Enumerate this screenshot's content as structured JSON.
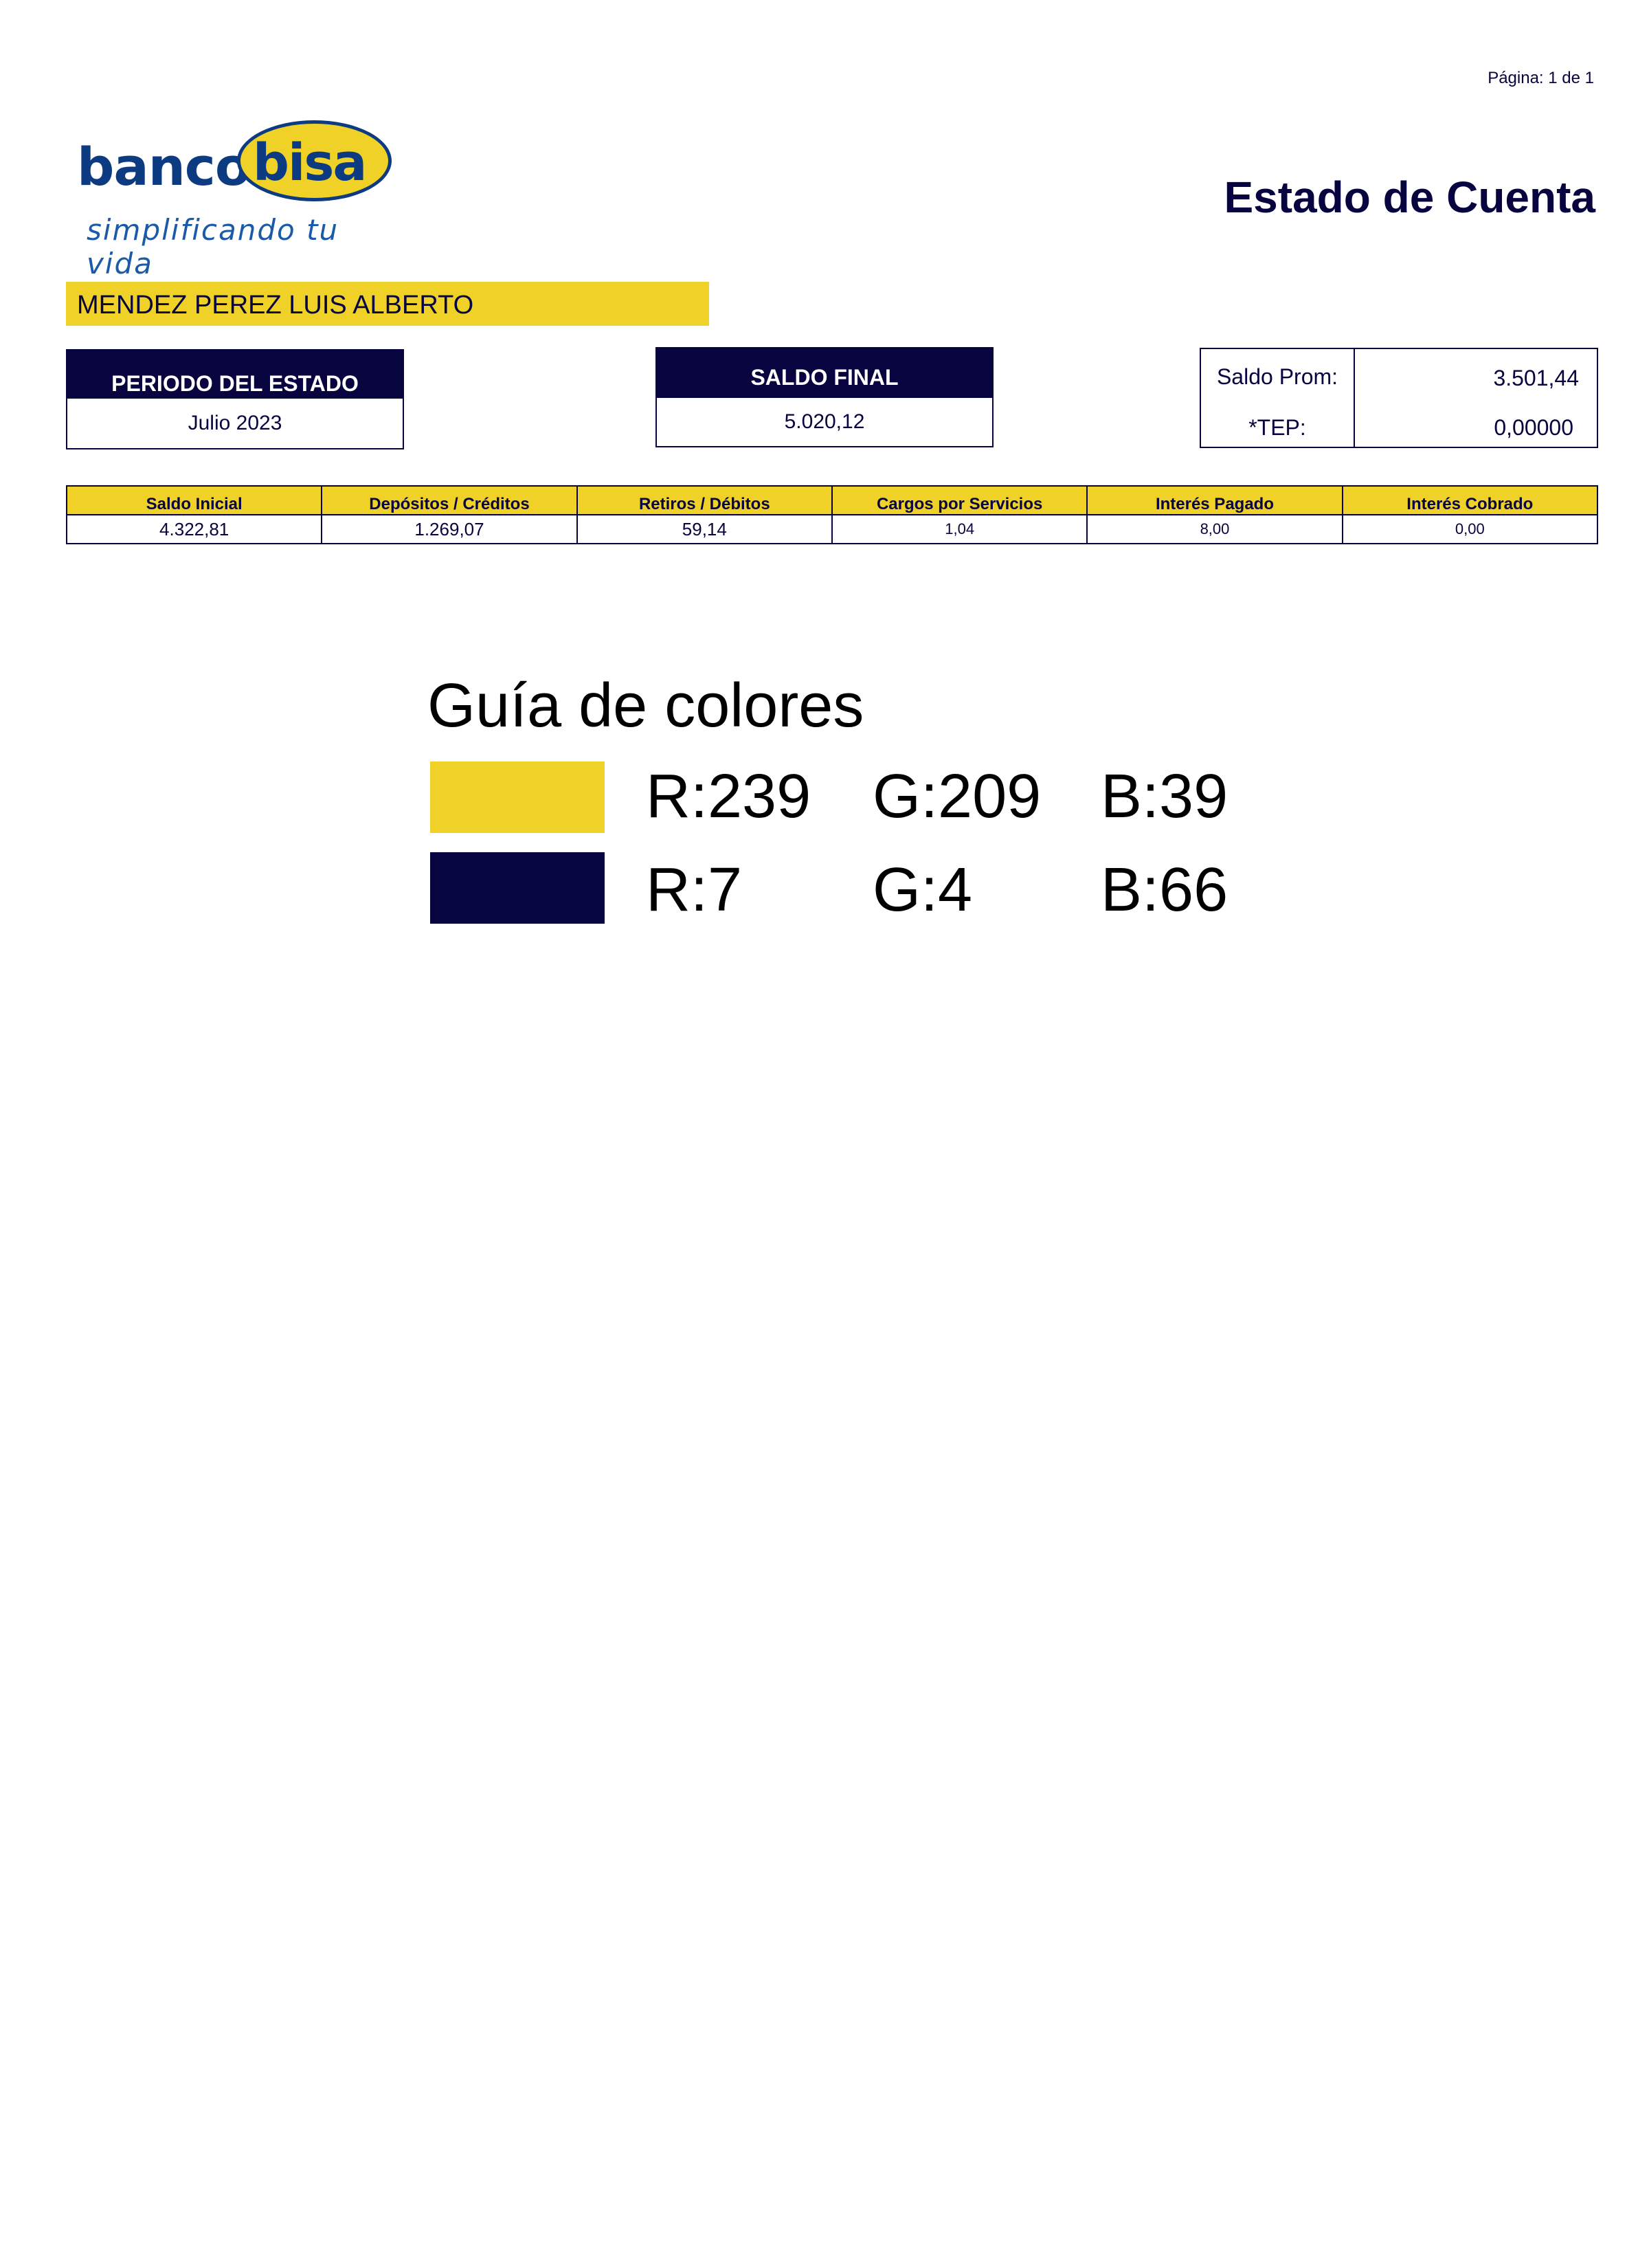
{
  "page": {
    "label": "Página: 1 de  1"
  },
  "logo": {
    "word": "banco",
    "oval": "bisa",
    "tagline": "simplificando tu vida"
  },
  "header": {
    "title": "Estado de Cuenta"
  },
  "client": {
    "name": "MENDEZ PEREZ LUIS ALBERTO"
  },
  "periodo": {
    "label": "PERIODO DEL ESTADO",
    "value": "Julio 2023"
  },
  "saldo_final": {
    "label": "SALDO FINAL",
    "value": "5.020,12"
  },
  "promedio": {
    "saldo_label": "Saldo Prom:",
    "saldo_value": "3.501,44",
    "tep_label": "*TEP:",
    "tep_value": "0,00000"
  },
  "summary": {
    "headers": [
      "Saldo Inicial",
      "Depósitos / Créditos",
      "Retiros / Débitos",
      "Cargos por Servicios",
      "Interés Pagado",
      "Interés Cobrado"
    ],
    "values": [
      "4.322,81",
      "1.269,07",
      "59,14",
      "1,04",
      "8,00",
      "0,00"
    ]
  },
  "color_guide": {
    "title": "Guía de colores",
    "rows": [
      {
        "hex": "#efd127",
        "r": "R:239",
        "g": "G:209",
        "b": "B:39"
      },
      {
        "hex": "#070442",
        "r": "R:7",
        "g": "G:4",
        "b": "B:66"
      }
    ]
  },
  "colors": {
    "yellow": "#efd127",
    "navy": "#07043f",
    "logo_blue": "#0d3b82"
  }
}
